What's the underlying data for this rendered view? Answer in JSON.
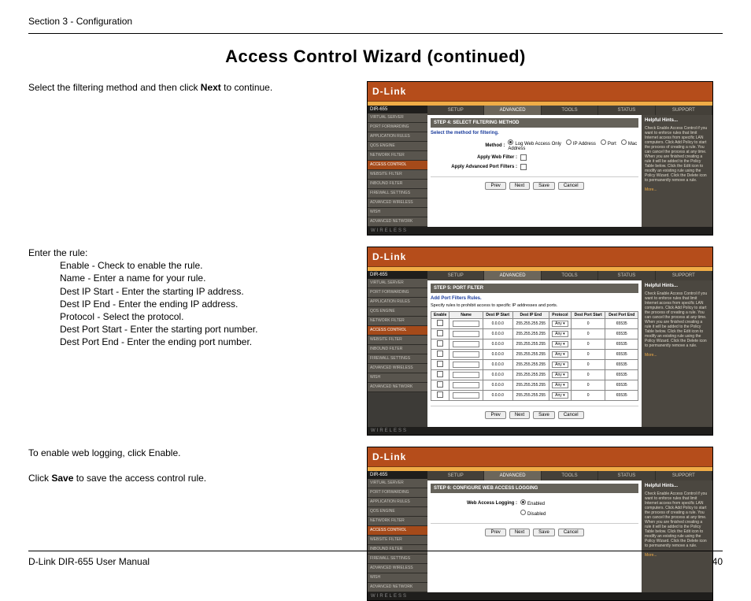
{
  "header": {
    "section": "Section 3 - Configuration"
  },
  "title": "Access Control Wizard (continued)",
  "blocks": {
    "b1_pre": "Select the filtering method and then click ",
    "b1_bold": "Next",
    "b1_post": " to continue.",
    "b2_intro": "Enter the rule:",
    "b2_lines": [
      "Enable - Check to enable the rule.",
      "Name - Enter a name for your rule.",
      "Dest IP Start - Enter the starting IP address.",
      "Dest IP End - Enter the ending IP address.",
      "Protocol - Select the protocol.",
      "Dest Port Start - Enter the starting port number.",
      "Dest Port End - Enter the ending port number."
    ],
    "b3_l1": "To enable web logging, click Enable.",
    "b3_l2_pre": "Click ",
    "b3_l2_bold": "Save",
    "b3_l2_post": " to save the access control rule."
  },
  "router": {
    "brand": "D-Link",
    "model": "DIR-655",
    "wireless": "WIRELESS",
    "tabs": [
      "SETUP",
      "ADVANCED",
      "TOOLS",
      "STATUS",
      "SUPPORT"
    ],
    "sidebar": [
      "VIRTUAL SERVER",
      "PORT FORWARDING",
      "APPLICATION RULES",
      "QOS ENGINE",
      "NETWORK FILTER",
      "ACCESS CONTROL",
      "WEBSITE FILTER",
      "INBOUND FILTER",
      "FIREWALL SETTINGS",
      "ADVANCED WIRELESS",
      "WISH",
      "ADVANCED NETWORK"
    ],
    "help_title": "Helpful Hints...",
    "more": "More..."
  },
  "shot1": {
    "step": "STEP 4: SELECT FILTERING METHOD",
    "lead": "Select the method for filtering.",
    "method_label": "Method :",
    "opts": [
      "Log Web Access Only",
      "IP Address",
      "Port",
      "Mac Address"
    ],
    "apply_web": "Apply Web Filter :",
    "apply_port": "Apply Advanced Port Filters :",
    "btns": [
      "Prev",
      "Next",
      "Save",
      "Cancel"
    ],
    "help": "Check Enable Access Control if you want to enforce rules that limit Internet access from specific LAN computers.\n\nClick Add Policy to start the process of creating a rule. You can cancel the process at any time. When you are finished creating a rule it will be added to the Policy Table below.\n\nClick the Edit icon to modify an existing rule using the Policy Wizard.\n\nClick the Delete icon to permanently remove a rule."
  },
  "shot2": {
    "step": "STEP 5: PORT FILTER",
    "lead1": "Add Port Filters Rules.",
    "lead2": "Specify rules to prohibit access to specific IP addresses and ports.",
    "cols": [
      "Enable",
      "Name",
      "Dest IP Start",
      "Dest IP End",
      "Protocol",
      "Dest Port Start",
      "Dest Port End"
    ],
    "row": {
      "start": "0.0.0.0",
      "end": "255.255.255.255",
      "proto": "Any",
      "pstart": "0",
      "pend": "65535"
    },
    "rows": 8,
    "btns": [
      "Prev",
      "Next",
      "Save",
      "Cancel"
    ],
    "help": "Check Enable Access Control if you want to enforce rules that limit Internet access from specific LAN computers.\n\nClick Add Policy to start the process of creating a rule. You can cancel the process at any time. When you are finished creating a rule it will be added to the Policy Table below.\n\nClick the Edit icon to modify an existing rule using the Policy Wizard.\n\nClick the Delete icon to permanently remove a rule."
  },
  "shot3": {
    "step": "STEP 6: CONFIGURE WEB ACCESS LOGGING",
    "label": "Web Access Logging :",
    "opt_on": "Enabled",
    "opt_off": "Disabled",
    "btns": [
      "Prev",
      "Next",
      "Save",
      "Cancel"
    ],
    "help": "Check Enable Access Control if you want to enforce rules that limit Internet access from specific LAN computers.\n\nClick Add Policy to start the process of creating a rule. You can cancel the process at any time. When you are finished creating a rule it will be added to the Policy Table below.\n\nClick the Edit icon to modify an existing rule using the Policy Wizard.\n\nClick the Delete icon to permanently remove a rule."
  },
  "footer": {
    "manual": "D-Link DIR-655 User Manual",
    "page": "40"
  }
}
